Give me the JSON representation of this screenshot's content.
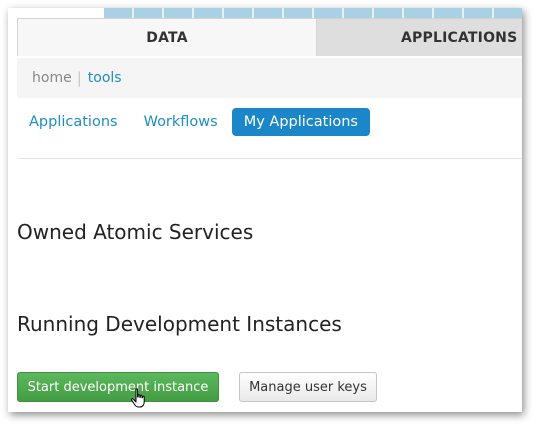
{
  "main_tabs": {
    "data_label": "DATA",
    "applications_label": "APPLICATIONS"
  },
  "breadcrumb": {
    "home": "home",
    "separator": "|",
    "tools": "tools"
  },
  "sub_tabs": [
    {
      "label": "Applications",
      "active": false
    },
    {
      "label": "Workflows",
      "active": false
    },
    {
      "label": "My Applications",
      "active": true
    }
  ],
  "sections": {
    "owned_title": "Owned Atomic Services",
    "running_title": "Running Development Instances"
  },
  "buttons": {
    "start_label": "Start development instance",
    "keys_label": "Manage user keys"
  },
  "icons": {
    "cursor": "hand-pointer-icon"
  },
  "colors": {
    "link": "#1f8ec2",
    "active_tab": "#1b87c9",
    "start_button": "#4cae4c"
  }
}
